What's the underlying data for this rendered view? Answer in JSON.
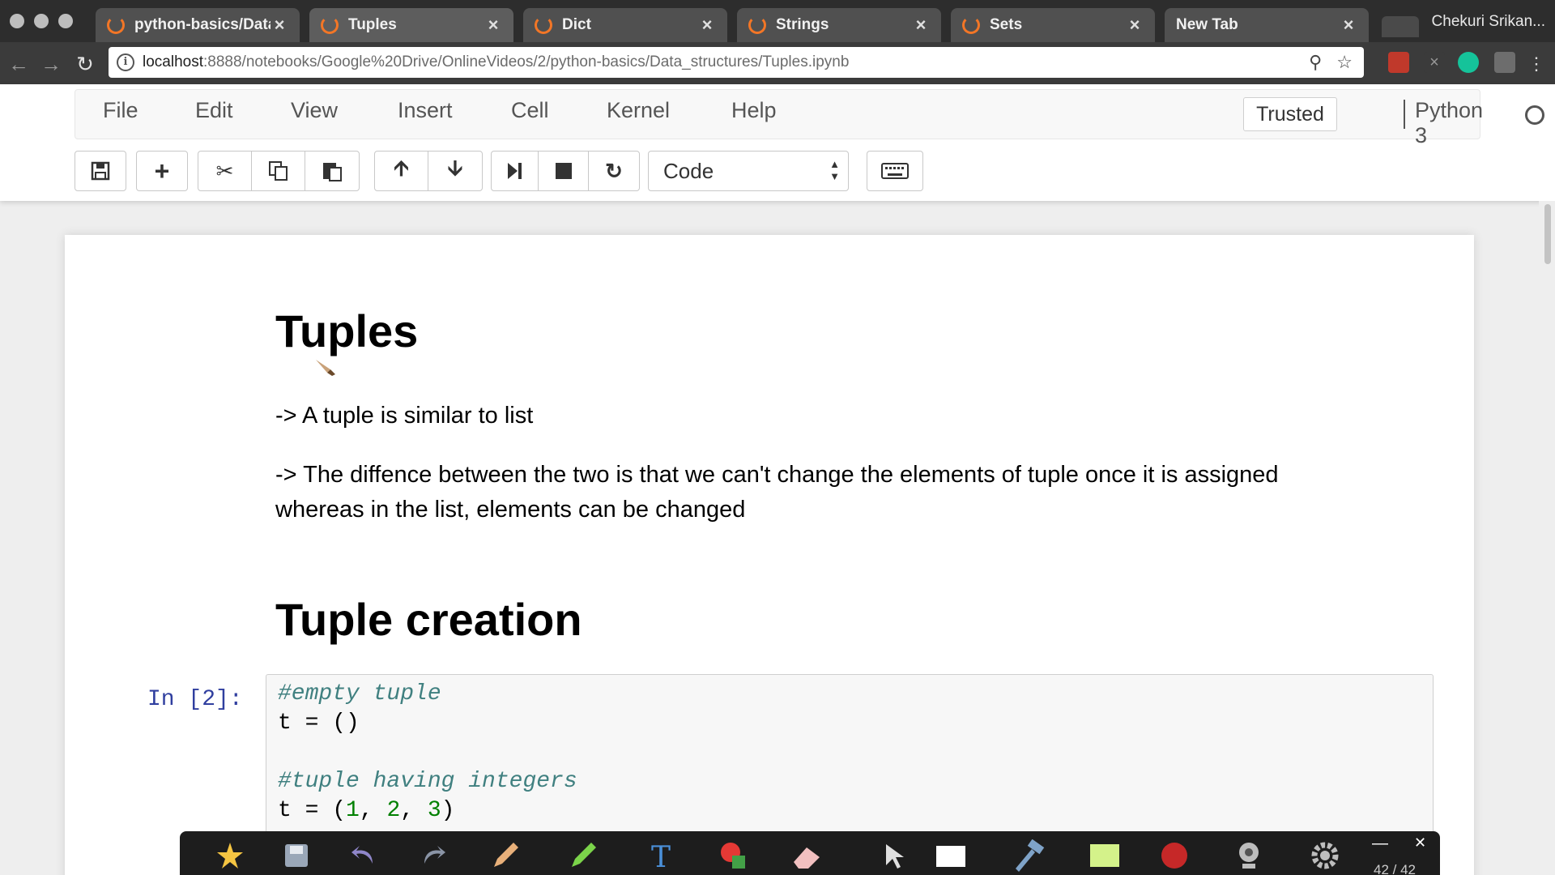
{
  "browser": {
    "tabs": [
      {
        "title": "python-basics/Data_"
      },
      {
        "title": "Tuples"
      },
      {
        "title": "Dict"
      },
      {
        "title": "Strings"
      },
      {
        "title": "Sets"
      },
      {
        "title": "New Tab"
      }
    ],
    "active_tab": "Tuples",
    "profile_name": "Chekuri Srikan...",
    "url_host": "localhost",
    "url_path": ":8888/notebooks/Google%20Drive/OnlineVideos/2/python-basics/Data_structures/Tuples.ipynb"
  },
  "jupyter": {
    "menu": [
      "File",
      "Edit",
      "View",
      "Insert",
      "Cell",
      "Kernel",
      "Help"
    ],
    "trusted_label": "Trusted",
    "kernel_name": "Python 3",
    "cell_type": "Code"
  },
  "notebook": {
    "title": "Tuples",
    "para1": "-> A tuple is similar to list",
    "para2_line1": "-> The diffence between the two is that we can't change the elements of tuple once it is assigned",
    "para2_line2": "whereas in the list, elements can be changed",
    "section_heading": "Tuple creation",
    "cell_prompt": "In [2]:",
    "code": {
      "line1_comment": "#empty tuple",
      "line2": "t = ()",
      "line4_comment": "#tuple having integers",
      "line5_prefix": "t = (",
      "line5_n1": "1",
      "line5_sep1": ", ",
      "line5_n2": "2",
      "line5_sep2": ", ",
      "line5_n3": "3",
      "line5_suffix": ")"
    }
  },
  "annotation_toolbar": {
    "page_counter": "42 / 42"
  },
  "colors": {
    "jupyter_orange": "#f37626",
    "prompt_blue": "#303f9f",
    "comment_teal": "#408080",
    "number_green": "#008000"
  }
}
